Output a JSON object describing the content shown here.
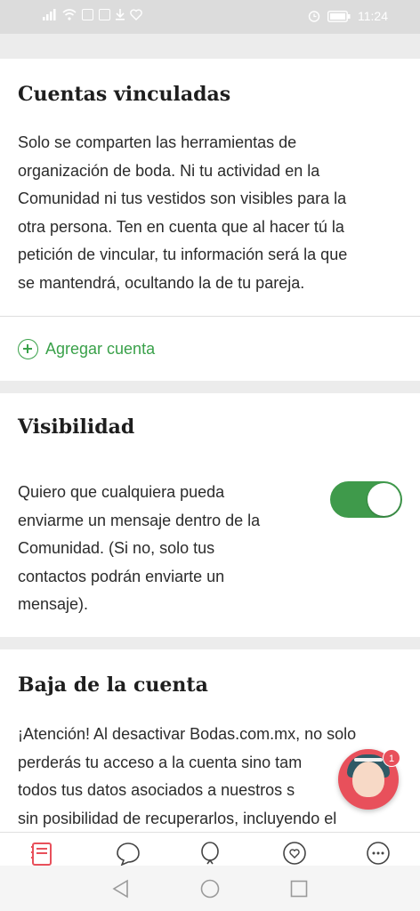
{
  "status_bar": {
    "time": "11:24",
    "left_icons": [
      "signal-icon",
      "wifi-icon",
      "mail-icon",
      "screenshot-icon",
      "download-icon",
      "heart-icon"
    ],
    "right_icons": [
      "alarm-icon",
      "battery-icon"
    ]
  },
  "linked_accounts": {
    "title": "Cuentas vinculadas",
    "description": [
      "Solo se comparten las herramientas de",
      "organización de boda. Ni tu actividad en la",
      "Comunidad ni tus vestidos son visibles para la",
      "otra persona. Ten en cuenta que al hacer tú la",
      "petición de vincular, tu información será la que",
      "se mantendrá, ocultando la de tu pareja."
    ],
    "add_account_label": "Agregar cuenta"
  },
  "visibility": {
    "title": "Visibilidad",
    "description": [
      "Quiero que cualquiera pueda",
      "enviarme un mensaje dentro de la",
      "Comunidad. (Si no, solo tus",
      "contactos podrán enviarte un",
      "mensaje)."
    ],
    "toggle_on": true
  },
  "deactivate": {
    "title": "Baja de la cuenta",
    "description": [
      "¡Atención! Al desactivar Bodas.com.mx, no solo",
      "perderás tu acceso a la cuenta sino tam",
      "todos tus datos asociados a nuestros s",
      "sin posibilidad de recuperarlos, incluyendo el"
    ]
  },
  "assistant": {
    "badge_count": "1"
  },
  "tabbar": {
    "tabs": [
      {
        "icon": "organizer-icon",
        "active": true
      },
      {
        "icon": "community-icon",
        "active": false
      },
      {
        "icon": "ideas-icon",
        "active": false
      },
      {
        "icon": "favorites-icon",
        "active": false
      },
      {
        "icon": "more-icon",
        "active": false
      }
    ]
  },
  "colors": {
    "accent_green": "#3aa14a",
    "toggle_green": "#3f9a4b",
    "brand_red": "#e8505b"
  }
}
